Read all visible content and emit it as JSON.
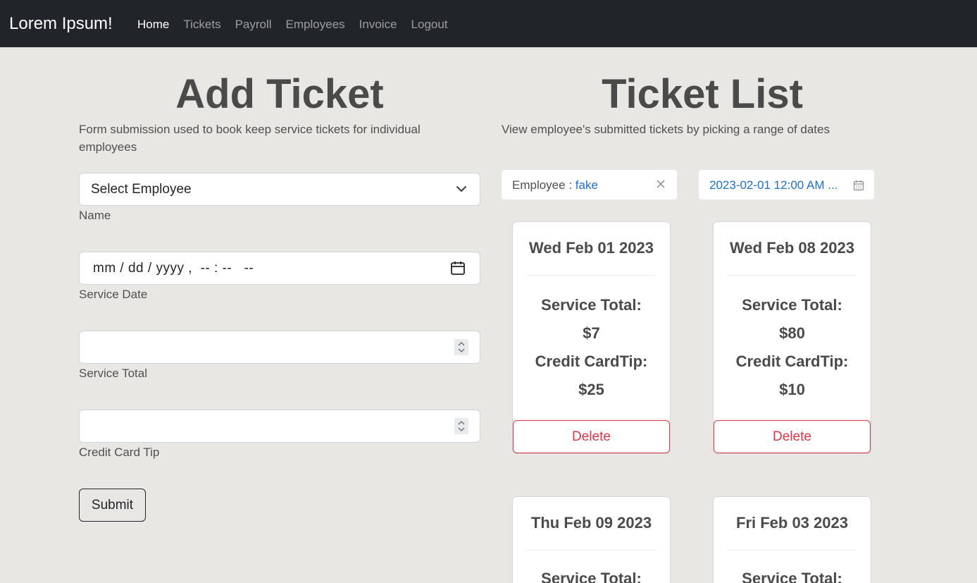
{
  "navbar": {
    "brand": "Lorem Ipsum!",
    "links": [
      "Home",
      "Tickets",
      "Payroll",
      "Employees",
      "Invoice",
      "Logout"
    ]
  },
  "add_ticket": {
    "title": "Add Ticket",
    "description": "Form submission used to book keep service tickets for individual employees",
    "employee_select": "Select Employee",
    "name_label": "Name",
    "date_placeholder": "mm / dd / yyyy ,  -- : --   --",
    "date_label": "Service Date",
    "service_total_label": "Service Total",
    "credit_tip_label": "Credit Card Tip",
    "submit_label": "Submit"
  },
  "ticket_list": {
    "title": "Ticket List",
    "description": "View employee's submitted tickets by picking a range of dates",
    "employee_filter_label": "Employee",
    "employee_filter_value": "fake",
    "date_range": "2023-02-01 12:00 AM ...",
    "service_total_label": "Service Total:",
    "credit_tip_label": "Credit CardTip:",
    "delete_label": "Delete",
    "tickets": [
      {
        "date": "Wed Feb 01 2023",
        "service_total": "$7",
        "credit_tip": "$25"
      },
      {
        "date": "Wed Feb 08 2023",
        "service_total": "$80",
        "credit_tip": "$10"
      },
      {
        "date": "Thu Feb 09 2023",
        "service_total": "",
        "credit_tip": ""
      },
      {
        "date": "Fri Feb 03 2023",
        "service_total": "",
        "credit_tip": ""
      }
    ]
  },
  "colors": {
    "navbar_bg": "#212529",
    "page_bg": "#e9e7e3",
    "accent_blue": "#1f6fd1",
    "danger": "#dc3545"
  },
  "icons": {
    "select": "chevron-down-icon",
    "date": "calendar-icon",
    "number": "spinner-icon",
    "clear": "close-icon",
    "range": "calendar-icon"
  }
}
